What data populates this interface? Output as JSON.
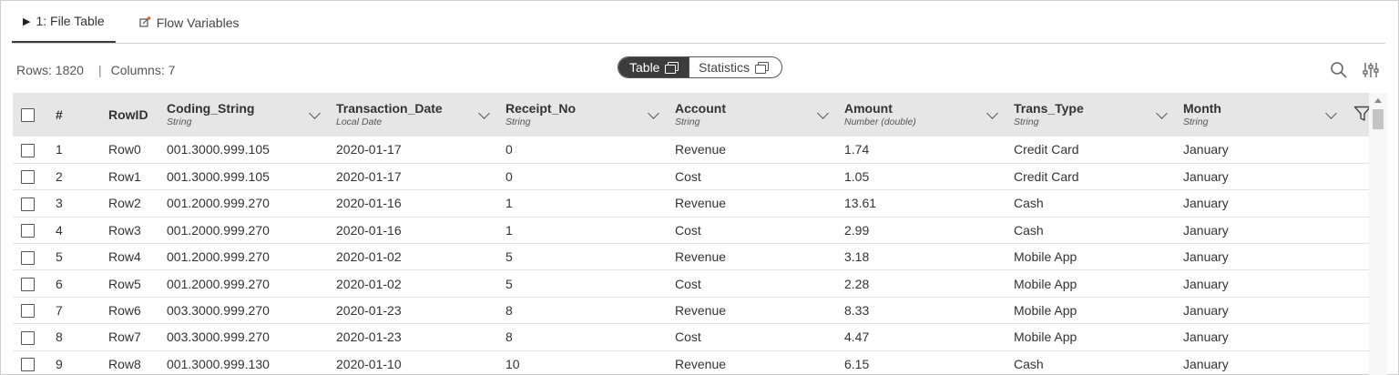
{
  "tabs": [
    {
      "label": "1: File Table",
      "icon": "play-icon",
      "active": true
    },
    {
      "label": "Flow Variables",
      "icon": "flow-variables-icon",
      "active": false
    }
  ],
  "summary": {
    "rows": "Rows: 1820",
    "separator": "|",
    "columns": "Columns: 7"
  },
  "view_toggle": {
    "table_label": "Table",
    "statistics_label": "Statistics",
    "selected": "Table"
  },
  "toolbar": {
    "search_icon": "search-icon",
    "settings_icon": "sliders-icon"
  },
  "table": {
    "headers": [
      {
        "name": "#",
        "type": ""
      },
      {
        "name": "RowID",
        "type": ""
      },
      {
        "name": "Coding_String",
        "type": "String"
      },
      {
        "name": "Transaction_Date",
        "type": "Local Date"
      },
      {
        "name": "Receipt_No",
        "type": "String"
      },
      {
        "name": "Account",
        "type": "String"
      },
      {
        "name": "Amount",
        "type": "Number (double)"
      },
      {
        "name": "Trans_Type",
        "type": "String"
      },
      {
        "name": "Month",
        "type": "String"
      }
    ],
    "rows": [
      [
        "1",
        "Row0",
        "001.3000.999.105",
        "2020-01-17",
        "0",
        "Revenue",
        "1.74",
        "Credit Card",
        "January"
      ],
      [
        "2",
        "Row1",
        "001.3000.999.105",
        "2020-01-17",
        "0",
        "Cost",
        "1.05",
        "Credit Card",
        "January"
      ],
      [
        "3",
        "Row2",
        "001.2000.999.270",
        "2020-01-16",
        "1",
        "Revenue",
        "13.61",
        "Cash",
        "January"
      ],
      [
        "4",
        "Row3",
        "001.2000.999.270",
        "2020-01-16",
        "1",
        "Cost",
        "2.99",
        "Cash",
        "January"
      ],
      [
        "5",
        "Row4",
        "001.2000.999.270",
        "2020-01-02",
        "5",
        "Revenue",
        "3.18",
        "Mobile App",
        "January"
      ],
      [
        "6",
        "Row5",
        "001.2000.999.270",
        "2020-01-02",
        "5",
        "Cost",
        "2.28",
        "Mobile App",
        "January"
      ],
      [
        "7",
        "Row6",
        "003.3000.999.270",
        "2020-01-23",
        "8",
        "Revenue",
        "8.33",
        "Mobile App",
        "January"
      ],
      [
        "8",
        "Row7",
        "003.3000.999.270",
        "2020-01-23",
        "8",
        "Cost",
        "4.47",
        "Mobile App",
        "January"
      ],
      [
        "9",
        "Row8",
        "001.3000.999.130",
        "2020-01-10",
        "10",
        "Revenue",
        "6.15",
        "Cash",
        "January"
      ]
    ]
  }
}
